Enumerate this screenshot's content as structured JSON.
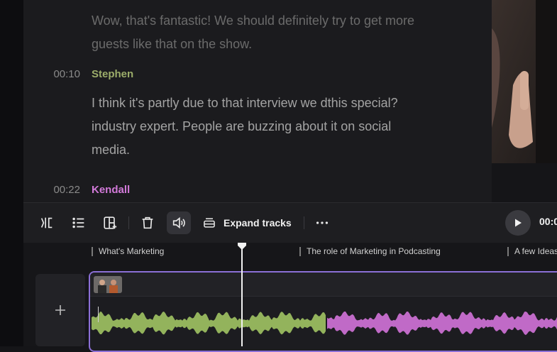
{
  "transcript": {
    "intro_lines": [
      "Wow, that's fantastic! We should definitely try to get more",
      "guests like that on the show."
    ],
    "entries": [
      {
        "time": "00:10",
        "speaker": "Stephen",
        "speaker_color": "#9cad6a",
        "lines": [
          "I think it's partly due to that interview we dthis special?",
          "industry expert. People are buzzing about it on social",
          "media."
        ]
      },
      {
        "time": "00:22",
        "speaker": "Kendall",
        "speaker_color": "#d27ad9",
        "lines": []
      }
    ]
  },
  "toolbar": {
    "split_icon": "split-icon",
    "list_icon": "list-icon",
    "add_layout_icon": "layout-add-icon",
    "delete_icon": "trash-icon",
    "volume_icon": "volume-icon",
    "expand_label": "Expand tracks",
    "more_icon": "more-dots-icon",
    "timecode": "00:0"
  },
  "timeline": {
    "chapters": [
      "What's Marketing",
      "The role of Marketing in Podcasting",
      "A few Ideas"
    ],
    "add_track_label": "+",
    "track_border_color": "#8b6fd6",
    "wave_colors": {
      "speaker_a": "#93b35c",
      "speaker_b": "#c06ac7"
    }
  }
}
